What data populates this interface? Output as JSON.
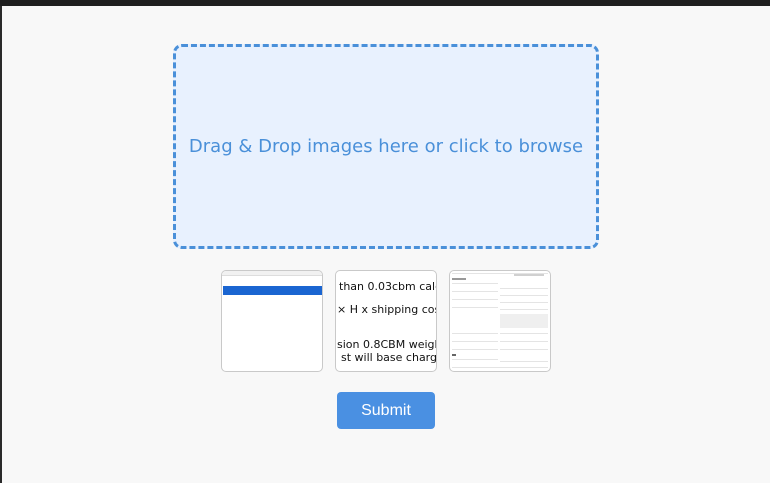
{
  "dropzone": {
    "text": "Drag & Drop images here or click to browse"
  },
  "thumbnails": {
    "thumb2_lines": [
      "than 0.03cbm calc",
      "× H x shipping cos",
      "sion 0.8CBM weigh",
      "st will base charge"
    ]
  },
  "submit": {
    "label": "Submit"
  },
  "colors": {
    "accent": "#4a90d9",
    "dropzone_bg": "#e8f1fe",
    "button_bg": "#4a90e2"
  }
}
